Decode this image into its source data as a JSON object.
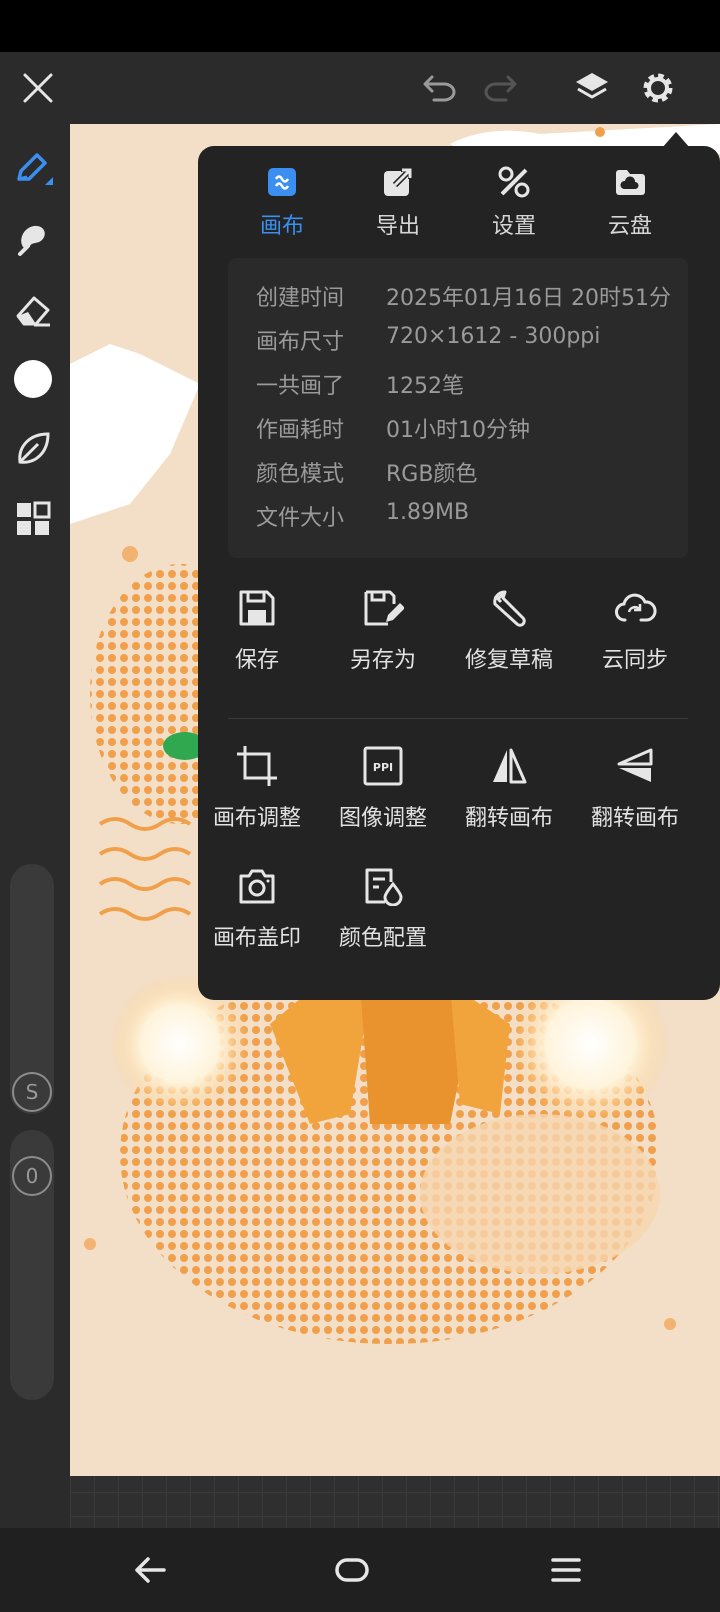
{
  "tabs": [
    {
      "label": "画布",
      "icon": "canvas-icon",
      "active": true
    },
    {
      "label": "导出",
      "icon": "export-icon",
      "active": false
    },
    {
      "label": "设置",
      "icon": "settings-tools-icon",
      "active": false
    },
    {
      "label": "云盘",
      "icon": "cloud-drive-icon",
      "active": false
    }
  ],
  "info": [
    {
      "label": "创建时间",
      "value": "2025年01月16日 20时51分"
    },
    {
      "label": "画布尺寸",
      "value": "720×1612 - 300ppi"
    },
    {
      "label": "一共画了",
      "value": "1252笔"
    },
    {
      "label": "作画耗时",
      "value": "01小时10分钟"
    },
    {
      "label": "颜色模式",
      "value": "RGB颜色"
    },
    {
      "label": "文件大小",
      "value": "1.89MB"
    }
  ],
  "actions_row1": [
    {
      "label": "保存",
      "icon": "save-icon"
    },
    {
      "label": "另存为",
      "icon": "save-as-icon"
    },
    {
      "label": "修复草稿",
      "icon": "repair-wrench-icon"
    },
    {
      "label": "云同步",
      "icon": "cloud-sync-icon"
    }
  ],
  "actions_row2": [
    {
      "label": "画布调整",
      "icon": "crop-icon"
    },
    {
      "label": "图像调整",
      "icon": "ppi-icon"
    },
    {
      "label": "翻转画布",
      "icon": "flip-horizontal-icon"
    },
    {
      "label": "翻转画布",
      "icon": "flip-vertical-icon"
    }
  ],
  "actions_row3": [
    {
      "label": "画布盖印",
      "icon": "camera-stamp-icon"
    },
    {
      "label": "颜色配置",
      "icon": "color-config-icon"
    }
  ],
  "sliders": {
    "size_label": "S",
    "opacity_label": "0"
  },
  "colors": {
    "accent": "#3a8ff0",
    "panel_bg": "#232323",
    "canvas_bg": "#f3dfc7",
    "art_orange": "#f0a04a"
  }
}
